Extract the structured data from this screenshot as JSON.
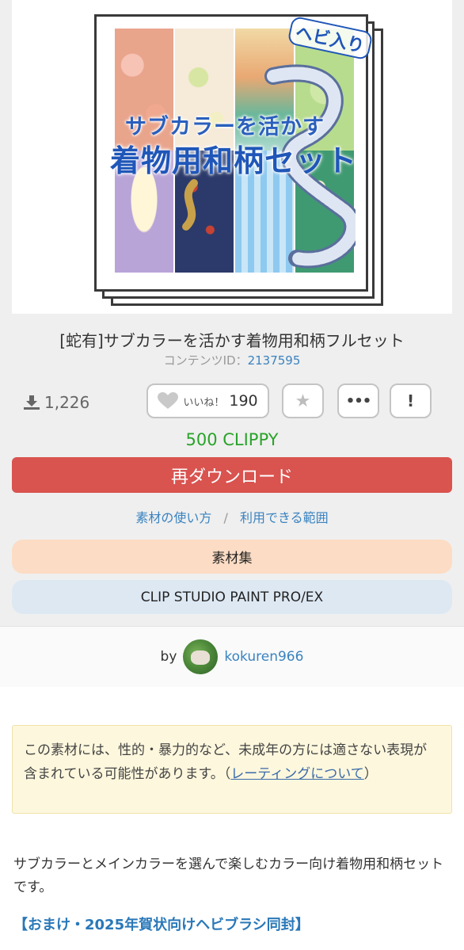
{
  "thumbnail": {
    "headline": "サブカラーを活かす",
    "subhead": "着物用和柄セット",
    "badge": "ヘビ入り"
  },
  "material": {
    "title": "[蛇有]サブカラーを活かす着物用和柄フルセット",
    "content_id_label": "コンテンツID：",
    "content_id": "2137595",
    "download_count": "1,226",
    "like_label": "いいね！",
    "like_count": "190",
    "price": "500 CLIPPY",
    "download_button": "再ダウンロード",
    "how_to_use": "素材の使い方",
    "separator": "/",
    "usage_scope": "利用できる範囲",
    "category": "素材集",
    "app": "CLIP STUDIO PAINT PRO/EX"
  },
  "author": {
    "by": "by",
    "name": "kokuren966"
  },
  "notice": {
    "text": "この素材には、性的・暴力的など、未成年の方には適さない表現が含まれている可能性があります。（",
    "link": "レーティングについて",
    "close": "）"
  },
  "description": {
    "text": "サブカラーとメインカラーを選んで楽しむカラー向け着物用和柄セットです。",
    "bonus": "【おまけ・2025年賀状向けヘビブラシ同封】"
  },
  "colors": {
    "download_button": "#d9534f",
    "price": "#29a329",
    "link": "#3a83c0",
    "category_pill": "#fcdcc4",
    "app_pill": "#dde8f3",
    "notice_bg": "#fdf7dd"
  }
}
